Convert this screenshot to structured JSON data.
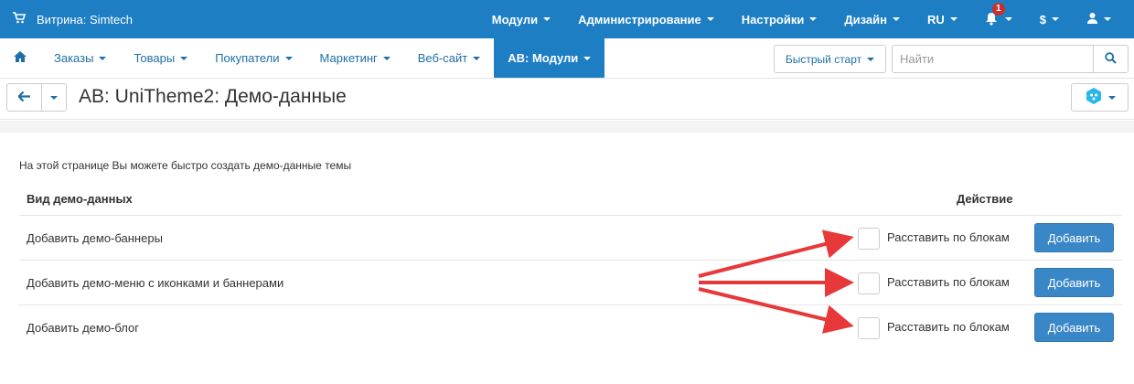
{
  "topbar": {
    "store_label": "Витрина: Simtech",
    "menu": [
      "Модули",
      "Администрирование",
      "Настройки",
      "Дизайн",
      "RU"
    ],
    "notifications_count": "1",
    "currency": "$"
  },
  "nav": {
    "tabs": [
      "Заказы",
      "Товары",
      "Покупатели",
      "Маркетинг",
      "Веб-сайт",
      "AB: Модули"
    ],
    "quick_start": "Быстрый старт",
    "search_placeholder": "Найти"
  },
  "page": {
    "title": "AB: UniTheme2: Демо-данные",
    "intro": "На этой странице Вы можете быстро создать демо-данные темы",
    "col_type": "Вид демо-данных",
    "col_action": "Действие",
    "rows": [
      {
        "label": "Добавить демо-баннеры",
        "checkbox_label": "Расставить по блокам",
        "button": "Добавить"
      },
      {
        "label": "Добавить демо-меню с иконками и баннерами",
        "checkbox_label": "Расставить по блокам",
        "button": "Добавить"
      },
      {
        "label": "Добавить демо-блог",
        "checkbox_label": "Расставить по блокам",
        "button": "Добавить"
      }
    ]
  },
  "colors": {
    "primary": "#1d7ec4",
    "button": "#3a87c8",
    "annotation_arrow": "#e8393a",
    "badge": "#c9302c"
  }
}
